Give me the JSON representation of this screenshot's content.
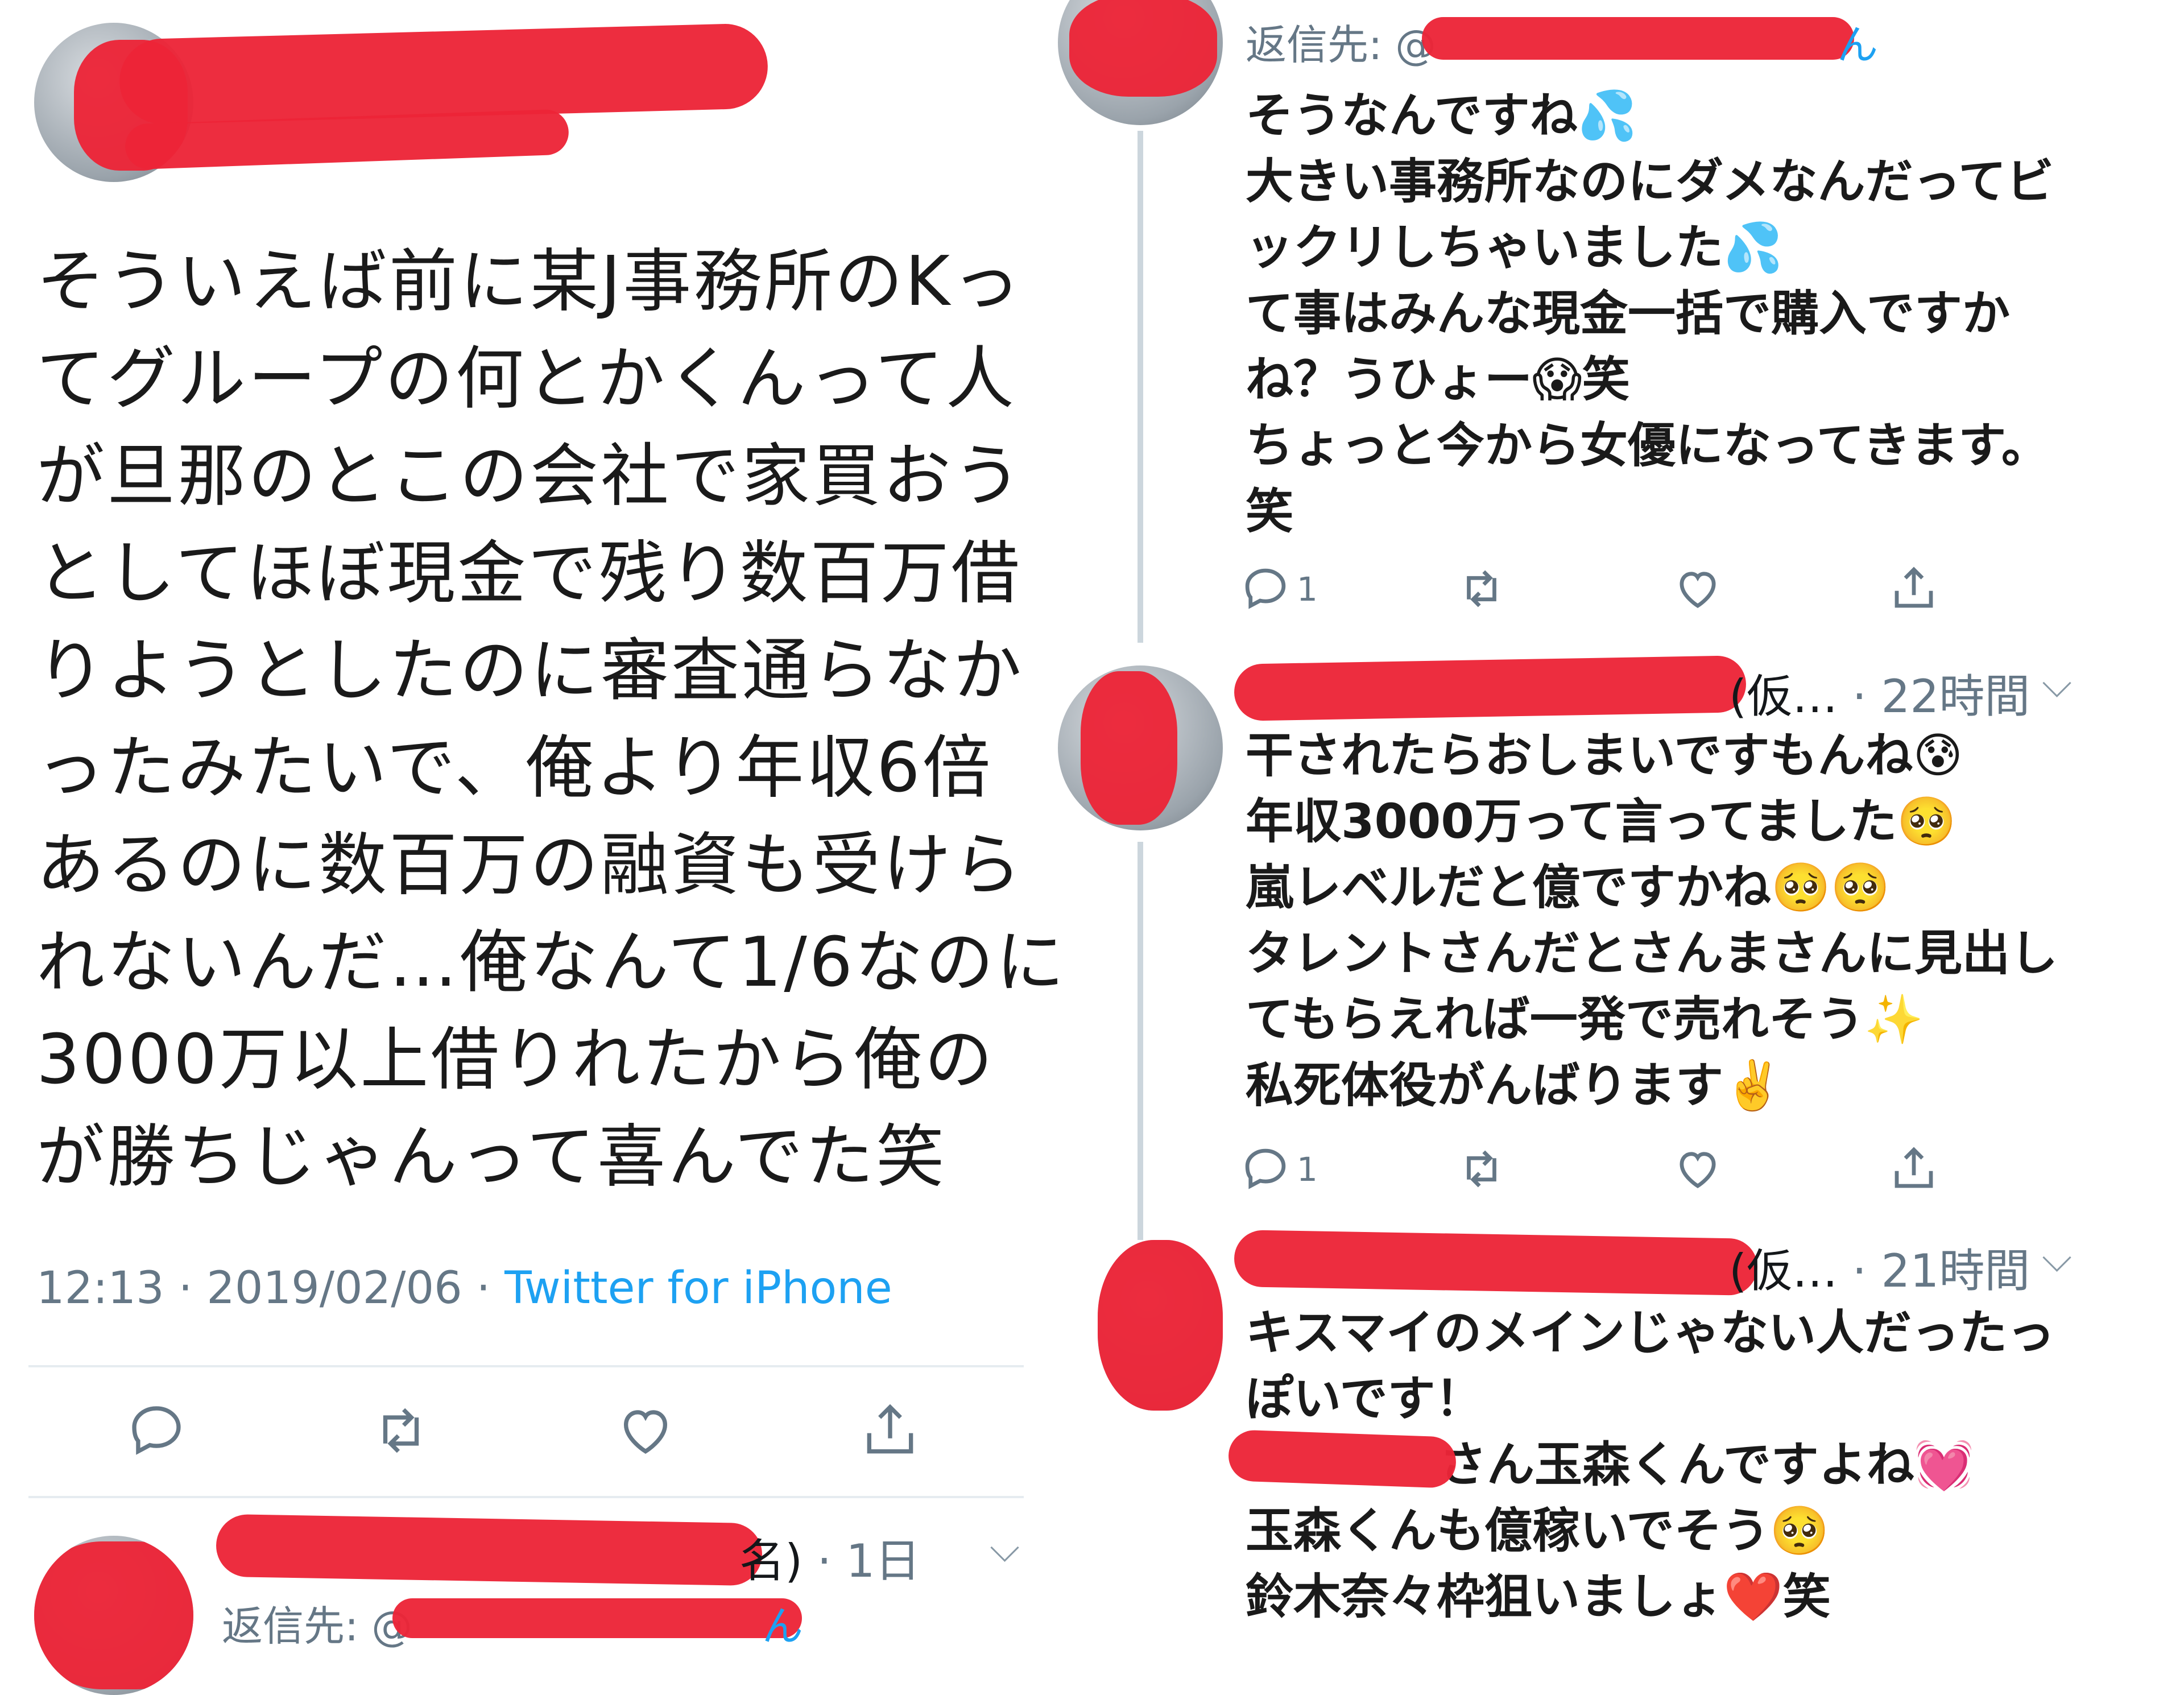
{
  "main_tweet": {
    "lines": [
      "そういえば前に某J事務所のKっ",
      "てグループの何とかくんって人",
      "が旦那のとこの会社で家買おう",
      "としてほぼ現金で残り数百万借",
      "りようとしたのに審査通らなか",
      "ったみたいで、俺より年収6倍",
      "あるのに数百万の融資も受けら",
      "れないんだ…俺なんて1/6なのに",
      "3000万以上借りれたから俺の",
      "が勝ちじゃんって喜んでた笑"
    ],
    "time": "12:13",
    "date": "2019/02/06",
    "separator": " · ",
    "source": "Twitter for iPhone"
  },
  "bottom_reply": {
    "name_suffix": "名)",
    "time_ago": "· 1日",
    "reply_to_prefix": "返信先: @",
    "reply_to_suffix": "ん"
  },
  "replies": [
    {
      "reply_to_prefix": "返信先: @",
      "reply_to_suffix": "ん",
      "lines": [
        "そうなんですね💦",
        "大きい事務所なのにダメなんだってビ",
        "ックリしちゃいました💦",
        "て事はみんな現金一括で購入ですか",
        "ね？うひょー😱笑",
        "ちょっと今から女優になってきます。",
        "笑"
      ],
      "reply_count": "1"
    },
    {
      "name_suffix": "(仮…",
      "time_ago": "· 22時間",
      "lines": [
        "干されたらおしまいですもんね😰",
        "年収3000万って言ってました🥺",
        "嵐レベルだと億ですかね🥺🥺",
        "タレントさんだとさんまさんに見出し",
        "てもらえれば一発で売れそう✨",
        "私死体役がんばります✌️"
      ],
      "reply_count": "1"
    },
    {
      "name_suffix": "(仮…",
      "time_ago": "· 21時間",
      "lines": [
        "キスマイのメインじゃない人だったっ",
        "ぽいです！",
        "さん玉森くんですよね💓",
        "玉森くんも億稼いでそう🥺",
        "鈴木奈々枠狙いましょ❤️笑"
      ]
    }
  ],
  "icons": {
    "reply": "reply-icon",
    "retweet": "retweet-icon",
    "like": "like-icon",
    "share": "share-icon",
    "chevron": "chevron-down-icon"
  },
  "colors": {
    "text": "#14171a",
    "secondary": "#657786",
    "link": "#1da1f2",
    "redaction": "#ec2437"
  }
}
